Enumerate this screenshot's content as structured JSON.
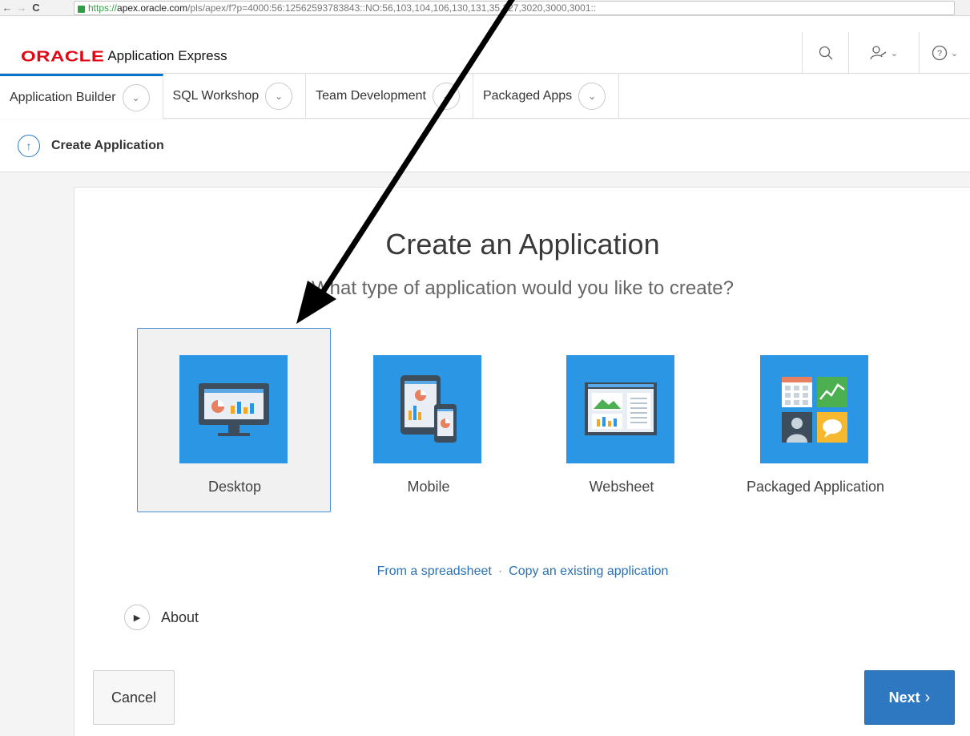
{
  "browser": {
    "back": "←",
    "forward": "→",
    "reload": "C",
    "url_secure": "https://",
    "url_host": "apex.oracle.com",
    "url_rest": "/pls/apex/f?p=4000:56:12562593783843::NO:56,103,104,106,130,131,35,227,3020,3000,3001::"
  },
  "header": {
    "brand": "ORACLE",
    "product": "Application Express",
    "brand_color": "#e30613",
    "icons": [
      "search-icon",
      "admin-user-icon",
      "help-icon"
    ]
  },
  "tabs": [
    {
      "label": "Application Builder",
      "active": true
    },
    {
      "label": "SQL Workshop",
      "active": false
    },
    {
      "label": "Team Development",
      "active": false
    },
    {
      "label": "Packaged Apps",
      "active": false
    }
  ],
  "breadcrumb": {
    "title": "Create Application"
  },
  "main": {
    "title": "Create an Application",
    "subtitle": "What type of application would you like to create?",
    "choices": [
      {
        "label": "Desktop",
        "icon": "desktop-icon",
        "selected": true
      },
      {
        "label": "Mobile",
        "icon": "mobile-icon",
        "selected": false
      },
      {
        "label": "Websheet",
        "icon": "websheet-icon",
        "selected": false
      },
      {
        "label": "Packaged Application",
        "icon": "packaged-app-icon",
        "selected": false
      }
    ],
    "links": {
      "spreadsheet": "From a spreadsheet",
      "separator": "·",
      "copy": "Copy an existing application"
    },
    "about": "About"
  },
  "buttons": {
    "cancel": "Cancel",
    "next": "Next"
  },
  "colors": {
    "accent": "#2b96e4",
    "link": "#2a72b5",
    "next_button": "#2d78c0"
  }
}
